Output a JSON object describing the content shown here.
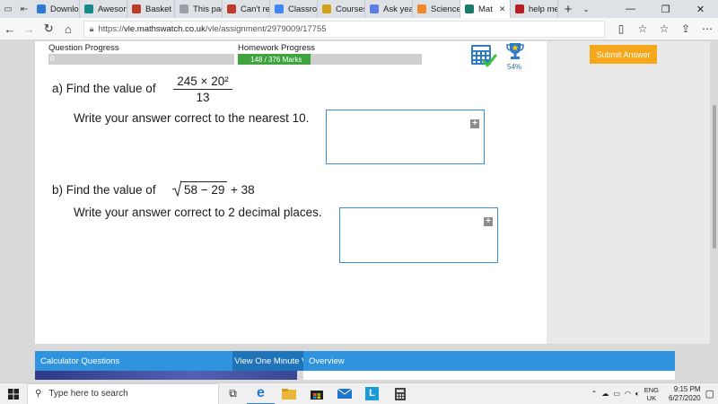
{
  "browser": {
    "tabs": [
      {
        "label": "Downlo",
        "icon": "windows-icon",
        "color": "#2b7bd6"
      },
      {
        "label": "Aweson",
        "icon": "bing-icon",
        "color": "#168a8a"
      },
      {
        "label": "Basket ·",
        "icon": "basket-icon",
        "color": "#c0392b"
      },
      {
        "label": "This pag",
        "icon": "page-icon",
        "color": "#9aa0a6"
      },
      {
        "label": "Can't re",
        "icon": "page-icon",
        "color": "#c0392b"
      },
      {
        "label": "Classroo",
        "icon": "google-icon",
        "color": "#4285f4"
      },
      {
        "label": "Courses",
        "icon": "courses-icon",
        "color": "#d4a017"
      },
      {
        "label": "Ask yea",
        "icon": "form-icon",
        "color": "#5b7ee5"
      },
      {
        "label": "Science",
        "icon": "science-icon",
        "color": "#f08a24"
      },
      {
        "label": "Mat",
        "icon": "mathswatch-icon",
        "color": "#1c7a6b",
        "active": true
      },
      {
        "label": "help me",
        "icon": "brainly-icon",
        "color": "#b81d24"
      }
    ],
    "url_prefix": "https://",
    "url_host": "vle.mathswatch.co.uk",
    "url_path": "/vle/assignment/2979009/17755"
  },
  "progress": {
    "question_label": "Question Progress",
    "question_value": "0",
    "question_fraction": 0,
    "homework_label": "Homework Progress",
    "homework_text": "148 / 376 Marks",
    "homework_fraction": 0.394,
    "percent": "54%"
  },
  "submit_label": "Submit Answer",
  "questions": {
    "a": {
      "prefix": "a)  Find the value of",
      "numerator": "245 × 20²",
      "denominator": "13",
      "instruction": "Write your answer correct to the nearest 10."
    },
    "b": {
      "prefix": "b)  Find the value of",
      "radicand": "58 − 29",
      "suffix": "+ 38",
      "instruction": "Write your answer correct to 2 decimal places."
    }
  },
  "bottom": {
    "calc_title": "Calculator Questions",
    "minute_button": "View One Minute Version",
    "overview_title": "Overview"
  },
  "taskbar": {
    "search_placeholder": "Type here to search",
    "lang_top": "ENG",
    "lang_bottom": "UK",
    "time": "9:15 PM",
    "date": "6/27/2020"
  },
  "colors": {
    "accent_orange": "#f5a81c",
    "progress_green": "#3fa43f",
    "panel_blue": "#2f93dd",
    "answer_border": "#3a8fd1"
  }
}
